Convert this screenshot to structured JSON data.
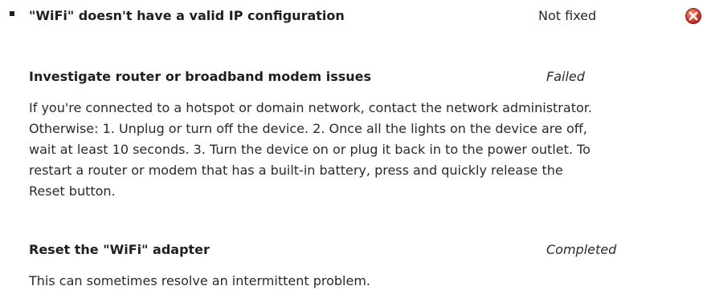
{
  "issue": {
    "title": "\"WiFi\" doesn't have a valid IP configuration",
    "status": "Not fixed",
    "status_icon": "error-circle-x-icon",
    "icon_color": "#d9534f"
  },
  "steps": [
    {
      "title": "Investigate router or broadband modem issues",
      "result": "Failed",
      "description": "If you're connected to a hotspot or domain network, contact the network administrator. Otherwise: 1. Unplug or turn off the device. 2. Once all the lights on the device are off, wait at least 10 seconds. 3. Turn the device on or plug it back in to the power outlet. To restart a router or modem that has a built-in battery, press and quickly release the Reset button."
    },
    {
      "title": "Reset the \"WiFi\" adapter",
      "result": "Completed",
      "description": "This can sometimes resolve an intermittent problem."
    }
  ]
}
